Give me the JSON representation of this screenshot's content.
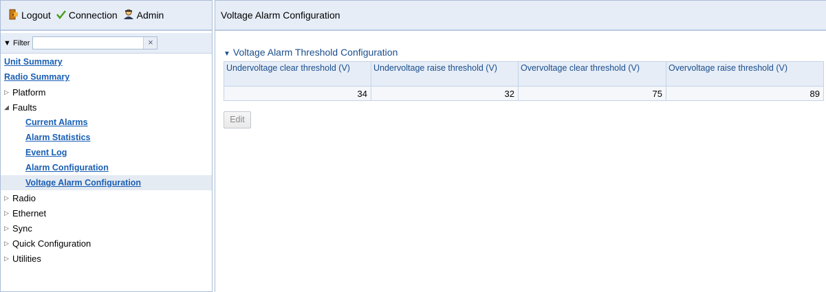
{
  "topbar": {
    "logout": "Logout",
    "connection": "Connection",
    "admin": "Admin"
  },
  "filter": {
    "label": "▼ Filter",
    "value": "",
    "clear": "×"
  },
  "nav": {
    "unit_summary": "Unit Summary",
    "radio_summary": "Radio Summary",
    "platform": "Platform",
    "faults": "Faults",
    "current_alarms": "Current Alarms",
    "alarm_statistics": "Alarm Statistics",
    "event_log": "Event Log",
    "alarm_configuration": "Alarm Configuration",
    "voltage_alarm_configuration": "Voltage Alarm Configuration",
    "radio": "Radio",
    "ethernet": "Ethernet",
    "sync": "Sync",
    "quick_configuration": "Quick Configuration",
    "utilities": "Utilities"
  },
  "page": {
    "title": "Voltage Alarm Configuration",
    "section_title": "Voltage Alarm Threshold Configuration"
  },
  "table": {
    "headers": [
      "Undervoltage clear threshold (V)",
      "Undervoltage raise threshold (V)",
      "Overvoltage clear threshold (V)",
      "Overvoltage raise threshold (V)"
    ],
    "row": [
      "34",
      "32",
      "75",
      "89"
    ]
  },
  "buttons": {
    "edit": "Edit"
  },
  "colors": {
    "link": "#1a5fb4",
    "header_bg": "#e6edf7",
    "section_title": "#1a4d8c"
  }
}
